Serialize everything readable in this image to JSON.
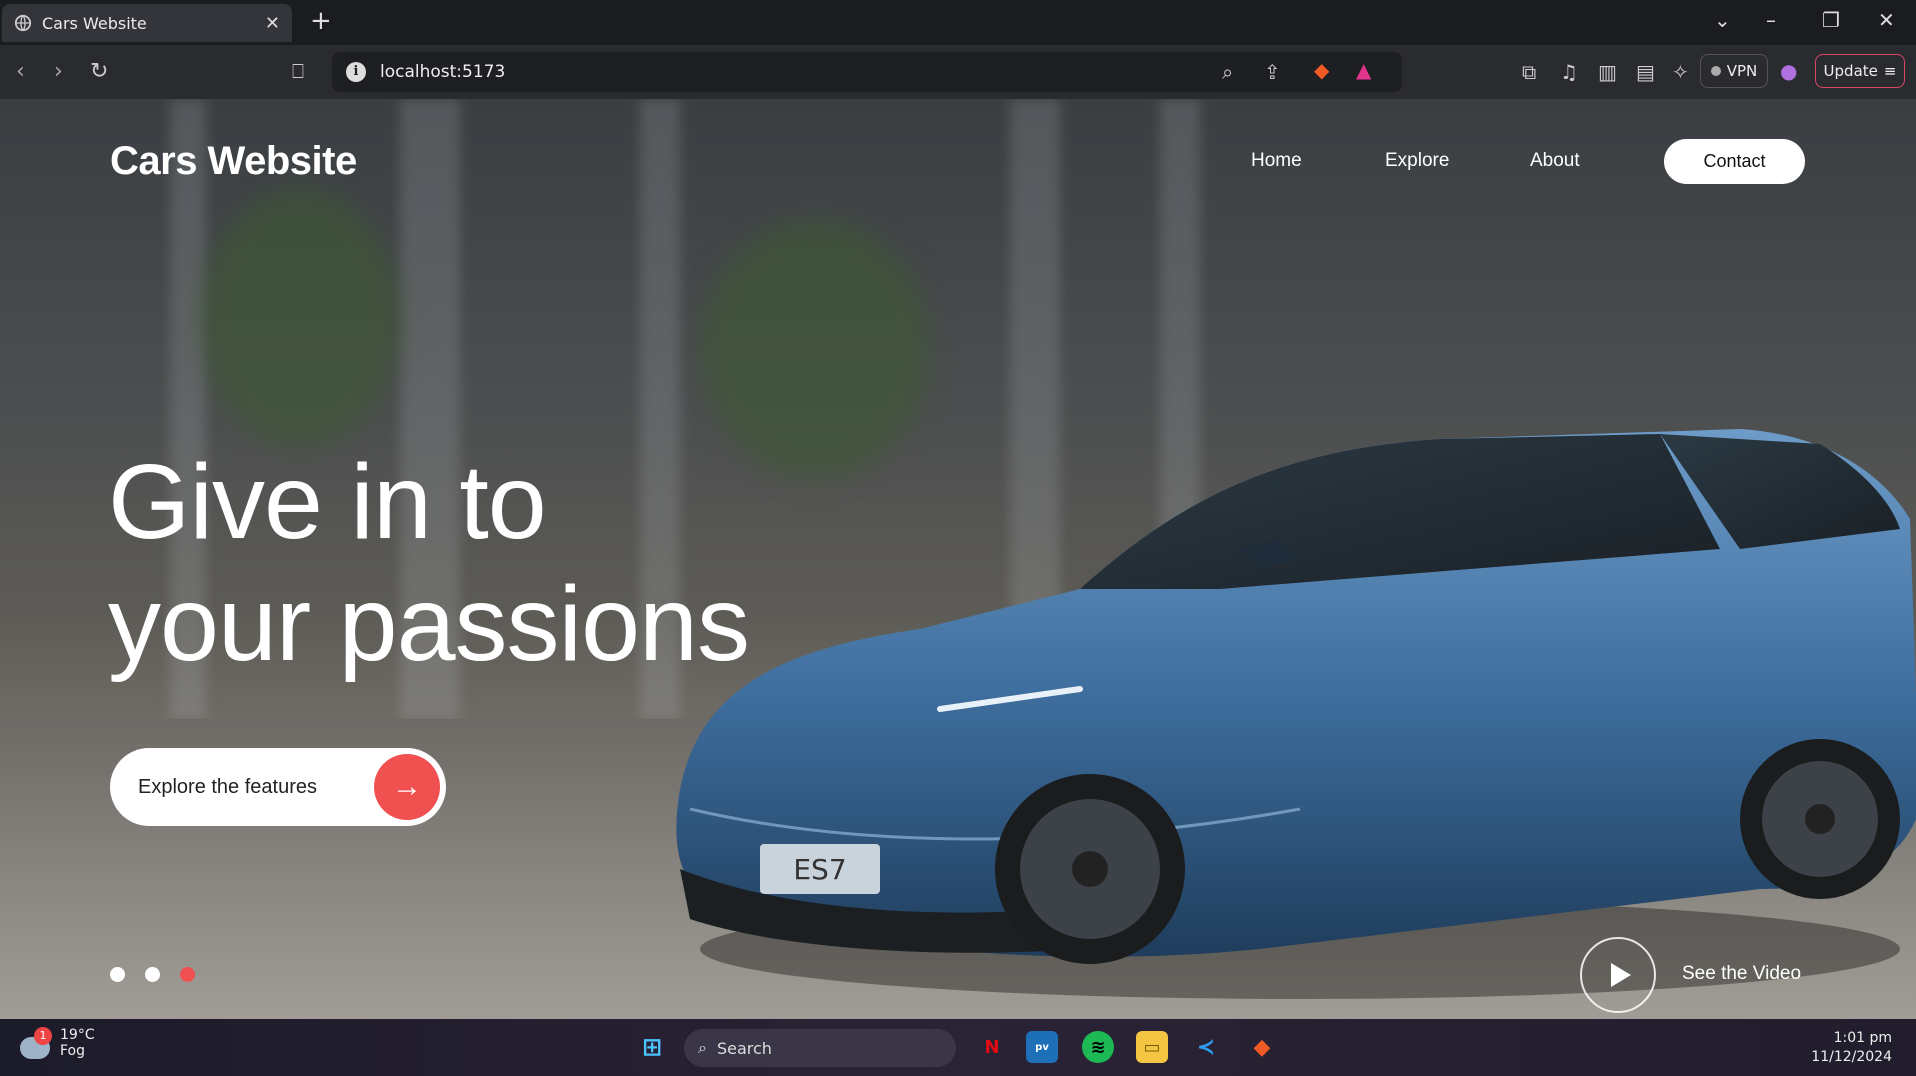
{
  "browser": {
    "tab_title": "Cars Website",
    "url": "localhost:5173",
    "vpn_label": "VPN",
    "update_label": "Update"
  },
  "site": {
    "brand": "Cars Website",
    "nav": {
      "home": "Home",
      "explore": "Explore",
      "about": "About",
      "contact": "Contact"
    },
    "headline_line1": "Give in to",
    "headline_line2": "your passions",
    "cta_label": "Explore the features",
    "see_video": "See the Video",
    "slide_indicators": {
      "count": 3,
      "active_index": 2
    },
    "accent_color": "#f0504f"
  },
  "taskbar": {
    "weather_temp": "19°C",
    "weather_desc": "Fog",
    "weather_badge": "1",
    "search_placeholder": "Search",
    "time": "1:01 pm",
    "date": "11/12/2024"
  },
  "car_plate": "ES7"
}
